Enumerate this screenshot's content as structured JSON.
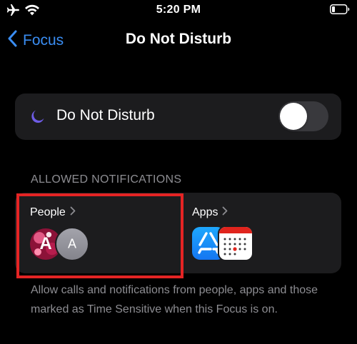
{
  "status_bar": {
    "time": "5:20 PM",
    "icons": [
      "airplane-icon",
      "wifi-icon",
      "battery-icon"
    ]
  },
  "nav": {
    "back_label": "Focus",
    "title": "Do Not Disturb"
  },
  "focus_toggle": {
    "label": "Do Not Disturb",
    "icon": "moon-icon",
    "enabled": false
  },
  "allowed": {
    "header": "ALLOWED NOTIFICATIONS",
    "people": {
      "label": "People",
      "avatars": [
        {
          "letter": "A",
          "icon": "avatar-photo"
        },
        {
          "letter": "A",
          "icon": "avatar-initial"
        }
      ]
    },
    "apps": {
      "label": "Apps",
      "icons": [
        "app-store-icon",
        "calendar-icon"
      ]
    }
  },
  "footer": "Allow calls and notifications from people, apps and those marked as Time Sensitive when this Focus is on.",
  "colors": {
    "accent": "#3a8df2",
    "moon": "#6e5ce6",
    "highlight": "#e42424",
    "card": "#1c1c1e",
    "secondary_text": "#8d8d92"
  }
}
